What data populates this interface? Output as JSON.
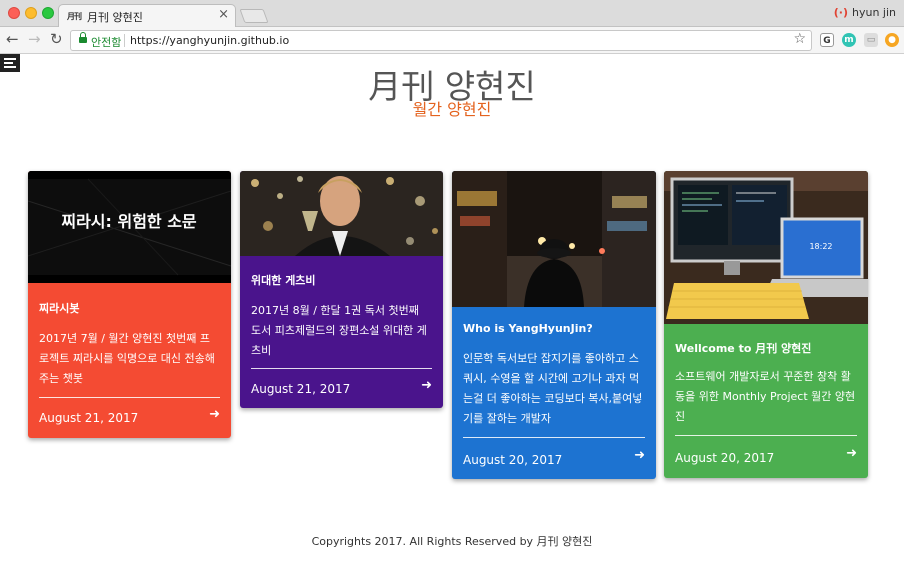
{
  "browser": {
    "tab_title": "月刊 양현진",
    "tab_favicon": "月刊",
    "tab_close": "×",
    "profile_name": "hyun jin",
    "secure_label": "안전함",
    "url": "https://yanghyunjin.github.io"
  },
  "site": {
    "title": "月刊 양현진",
    "subtitle": "월간 양현진",
    "accent_color": "#e4631f"
  },
  "cards": [
    {
      "title": "찌라시봇",
      "image_caption": "찌라시: 위험한 소문",
      "description": "2017년 7월 / 월간 양현진 첫번째 프로젝트 찌라시를 익명으로 대신 전송해주는 챗봇",
      "date": "August 21, 2017",
      "color": "#f44b33",
      "icon": "arrow-right-icon"
    },
    {
      "title": "위대한 게츠비",
      "description": "2017년 8월 / 한달 1권 독서 첫번째 도서 피츠제럴드의 장편소설 위대한 게츠비",
      "date": "August 21, 2017",
      "color": "#4a148c",
      "icon": "arrow-right-icon"
    },
    {
      "title": "Who is YangHyunJin?",
      "description": "인문학 독서보단 잡지기를 좋아하고 스쿼시, 수영을 할 시간에 고기나 과자 먹는걸 더 좋아하는 코딩보다 복사,붙여넣기를 잘하는 개발자",
      "date": "August 20, 2017",
      "color": "#1d73d1",
      "icon": "arrow-right-icon"
    },
    {
      "title": "Wellcome to 月刊 양현진",
      "description": "소프트웨어 개발자로서 꾸준한 창착 활동을 위한 Monthly Project 월간 양현진",
      "date": "August 20, 2017",
      "color": "#4caf50",
      "icon": "arrow-right-icon"
    }
  ],
  "laptop_clock": "18:22",
  "footer": "Copyrights 2017. All Rights Reserved by 月刊 양현진"
}
